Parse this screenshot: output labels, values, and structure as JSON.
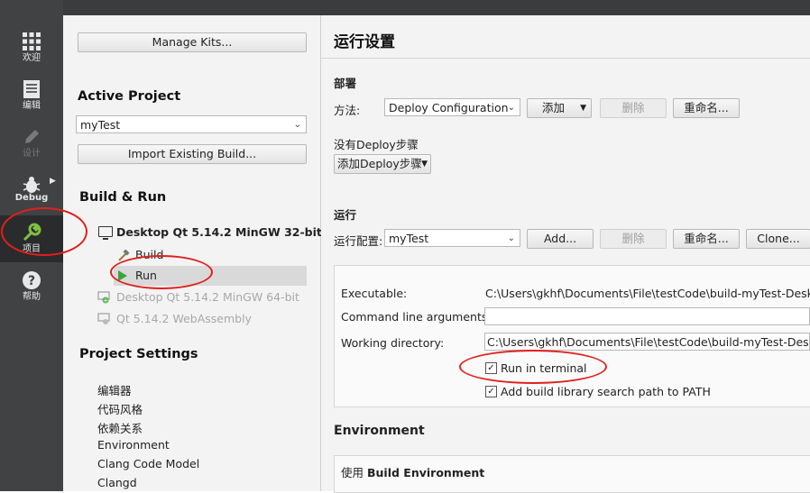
{
  "modes": [
    {
      "label": "欢迎",
      "icon": "grid-icon"
    },
    {
      "label": "编辑",
      "icon": "document-icon"
    },
    {
      "label": "设计",
      "icon": "pencil-icon"
    },
    {
      "label": "Debug",
      "icon": "bug-icon"
    },
    {
      "label": "项目",
      "icon": "wrench-icon"
    },
    {
      "label": "帮助",
      "icon": "help-icon"
    }
  ],
  "left": {
    "manage_kits": "Manage Kits...",
    "active_project_title": "Active Project",
    "active_project_value": "myTest",
    "import_build": "Import Existing Build...",
    "build_run_title": "Build & Run",
    "kit_active": "Desktop Qt 5.14.2 MinGW 32-bit",
    "build_label": "Build",
    "run_label": "Run",
    "kit_64": "Desktop Qt 5.14.2 MinGW 64-bit",
    "kit_wasm": "Qt 5.14.2 WebAssembly",
    "project_settings_title": "Project Settings",
    "settings_items": [
      "编辑器",
      "代码风格",
      "依赖关系",
      "Environment",
      "Clang Code Model",
      "Clangd"
    ]
  },
  "right": {
    "page_title": "运行设置",
    "deploy_title": "部署",
    "method_label": "方法:",
    "deploy_config": "Deploy Configuration",
    "add_label": "添加",
    "remove_label": "删除",
    "rename_label": "重命名...",
    "no_deploy_steps": "没有Deploy步骤",
    "add_deploy_step": "添加Deploy步骤",
    "run_title": "运行",
    "run_config_label": "运行配置:",
    "run_config_value": "myTest",
    "add_btn": "Add...",
    "clone_btn": "Clone...",
    "executable_label": "Executable:",
    "executable_value": "C:\\Users\\gkhf\\Documents\\File\\testCode\\build-myTest-Desktop",
    "cmd_args_label": "Command line arguments:",
    "cmd_args_value": "",
    "working_dir_label": "Working directory:",
    "working_dir_value": "C:\\Users\\gkhf\\Documents\\File\\testCode\\build-myTest-Desktop",
    "run_in_terminal": "Run in terminal",
    "run_in_terminal_checked": true,
    "add_lib_path": "Add build library search path to PATH",
    "add_lib_path_checked": true,
    "environment_title": "Environment",
    "use_prefix": "使用",
    "use_env": "Build Environment"
  },
  "colors": {
    "annotation": "#e0201c",
    "accent_green": "#7fc141",
    "sidebar": "#404244"
  }
}
